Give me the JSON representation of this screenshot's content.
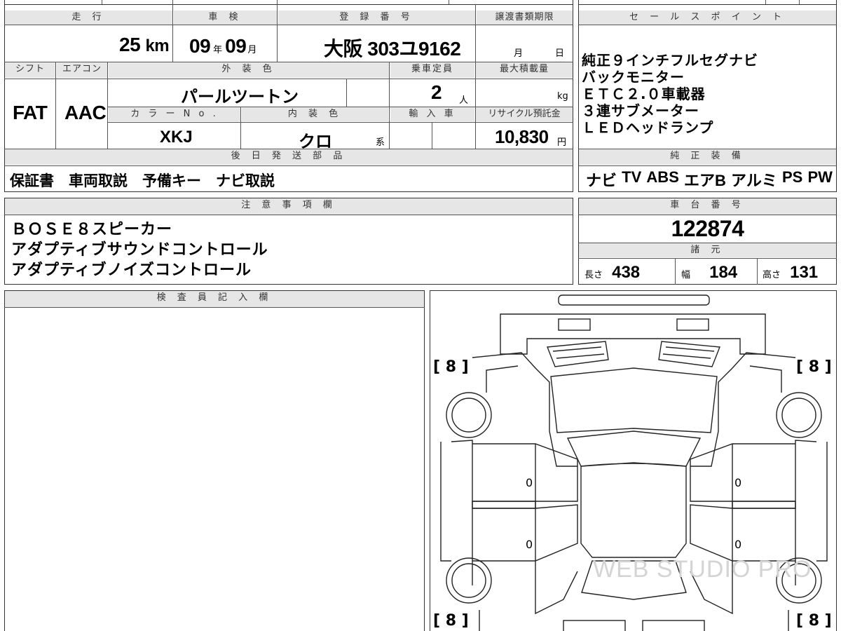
{
  "main_table": {
    "headers": {
      "mileage": "走 行",
      "inspection": "車 検",
      "registration": "登 録 番 号",
      "transfer_deadline": "譲渡書類期限",
      "shift": "シフト",
      "aircon": "エアコン",
      "exterior_color": "外 装 色",
      "capacity": "乗車定員",
      "max_load": "最大積載量",
      "color_no": "カ ラ ー N o .",
      "interior_color": "内 装 色",
      "import": "輸 入 車",
      "recycle_fee": "リサイクル預託金",
      "later_parts": "後 日 発 送 部 品"
    },
    "mileage_value": "25",
    "mileage_unit": "km",
    "inspection_year": "09",
    "inspection_year_unit": "年",
    "inspection_month": "09",
    "inspection_month_unit": "月",
    "registration_number": "大阪 303ユ9162",
    "deadline_month_unit": "月",
    "deadline_day_unit": "日",
    "shift_value": "FAT",
    "aircon_value": "AAC",
    "exterior_color_value": "パールツートン",
    "capacity_value": "2",
    "capacity_unit": "人",
    "max_load_unit": "kg",
    "color_no_value": "XKJ",
    "interior_color_value": "クロ",
    "interior_color_suffix": "系",
    "recycle_fee_value": "10,830",
    "recycle_fee_unit": "円",
    "later_parts_value": "保証書　車両取説　予備キー　ナビ取説"
  },
  "sales_points": {
    "header": "セ ー ル ス ポ イ ン ト",
    "items": [
      "純正９インチフルセグナビ",
      "バックモニター",
      "ＥＴＣ２.０車載器",
      "３連サブメーター",
      "ＬＥＤヘッドランプ"
    ]
  },
  "equipment": {
    "header": "純 正 装 備",
    "items": [
      "ナビ",
      "TV",
      "ABS",
      "エアB",
      "アルミ",
      "PS",
      "PW"
    ]
  },
  "notes": {
    "header": "注 意 事 項 欄",
    "lines": [
      "ＢＯＳＥ８スピーカー",
      "アダプティブサウンドコントロール",
      "アダプティブノイズコントロール"
    ]
  },
  "chassis": {
    "header": "車 台 番 号",
    "value": "122874"
  },
  "specs": {
    "header": "諸 元",
    "length_label": "長さ",
    "length_value": "438",
    "width_label": "幅",
    "width_value": "184",
    "height_label": "高さ",
    "height_value": "131"
  },
  "inspector": {
    "header": "検 査 員 記 入 欄"
  },
  "diagram": {
    "tire_labels": [
      "[ 8 ]",
      "[ 8 ]",
      "[ 8 ]",
      "[ 8 ]"
    ],
    "panel_marks": [
      "0",
      "0",
      "0",
      "0"
    ],
    "watermark": "WEB STUDIO PRO"
  }
}
